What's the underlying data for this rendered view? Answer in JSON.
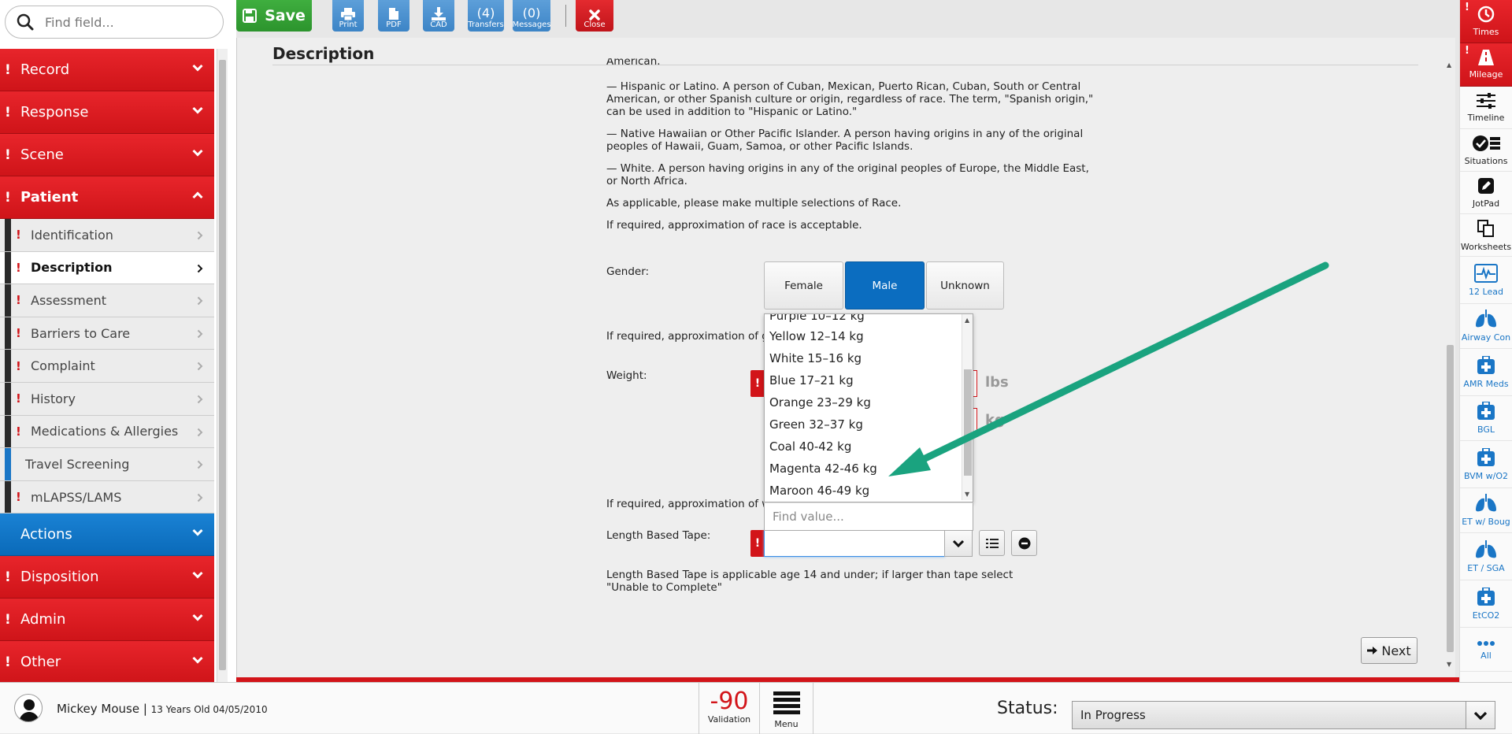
{
  "search": {
    "placeholder": "Find field..."
  },
  "sidebar": {
    "sections_top": [
      {
        "label": "Record",
        "required": true
      },
      {
        "label": "Response",
        "required": true
      },
      {
        "label": "Scene",
        "required": true
      },
      {
        "label": "Patient",
        "required": true,
        "expanded": true
      }
    ],
    "patient_items": [
      {
        "label": "Identification",
        "required": true
      },
      {
        "label": "Description",
        "required": true,
        "active": true
      },
      {
        "label": "Assessment",
        "required": true
      },
      {
        "label": "Barriers to Care",
        "required": true
      },
      {
        "label": "Complaint",
        "required": true
      },
      {
        "label": "History",
        "required": true
      },
      {
        "label": "Medications & Allergies",
        "required": true
      },
      {
        "label": "Travel Screening",
        "required": false
      },
      {
        "label": "mLAPSS/LAMS",
        "required": true
      }
    ],
    "sections_bottom": [
      {
        "label": "Actions",
        "required": false
      },
      {
        "label": "Disposition",
        "required": true
      },
      {
        "label": "Admin",
        "required": true
      },
      {
        "label": "Other",
        "required": true
      }
    ]
  },
  "toolbar": {
    "save_label": "Save",
    "print_label": "Print",
    "pdf_label": "PDF",
    "cad_label": "CAD",
    "transfers_count": "(4)",
    "transfers_label": "Transfers",
    "messages_count": "(0)",
    "messages_label": "Messages",
    "close_label": "Close"
  },
  "main": {
    "title": "Description",
    "race_text": {
      "cut_top": "American.",
      "hispanic": "— Hispanic or Latino. A person of Cuban, Mexican, Puerto Rican, Cuban, South or Central American, or other Spanish culture or origin, regardless of race. The term, \"Spanish origin,\" can be used in addition to \"Hispanic or Latino.\"",
      "hawaiian": "— Native Hawaiian or Other Pacific Islander. A person having origins in any of the original peoples of Hawaii, Guam, Samoa, or other Pacific Islands.",
      "white": "— White. A person having origins in any of the original peoples of Europe, the Middle East, or North Africa.",
      "multiple": "As applicable, please make multiple selections of Race.",
      "approx": "If required, approximation of race is acceptable."
    },
    "gender": {
      "label": "Gender:",
      "options": [
        "Female",
        "Male",
        "Unknown"
      ],
      "selected": "Male",
      "approx": "If required, approximation of ge"
    },
    "weight": {
      "label": "Weight:",
      "unit_lbs": "lbs",
      "unit_kg": "kg",
      "approx": "If required, approximation of we"
    },
    "length_tape": {
      "label": "Length Based Tape:",
      "value": "",
      "note": "Length Based Tape is applicable age 14 and under; if larger than tape select \"Unable to Complete\""
    },
    "dropdown": {
      "options": [
        "Purple 10–12 kg",
        "Yellow 12–14 kg",
        "White 15–16 kg",
        "Blue 17–21 kg",
        "Orange 23–29 kg",
        "Green 32–37 kg",
        "Coal 40-42 kg",
        "Magenta 42-46 kg",
        "Maroon 46-49 kg"
      ],
      "find_placeholder": "Find value..."
    },
    "next_label": "Next",
    "annotation_color": "#1aa37f"
  },
  "rightbar": [
    {
      "label": "Times",
      "icon": "clock-icon",
      "red": true
    },
    {
      "label": "Mileage",
      "icon": "road-icon",
      "red": true
    },
    {
      "label": "Timeline",
      "icon": "sliders-icon",
      "red": false
    },
    {
      "label": "Situations",
      "icon": "check-list-icon",
      "red": false
    },
    {
      "label": "JotPad",
      "icon": "pencil-icon",
      "red": false
    },
    {
      "label": "Worksheets",
      "icon": "copy-icon",
      "red": false
    },
    {
      "label": "12 Lead",
      "icon": "ecg-icon",
      "red": false
    },
    {
      "label": "Airway Con",
      "icon": "lungs-icon",
      "red": false
    },
    {
      "label": "AMR Meds",
      "icon": "medkit-icon",
      "red": false
    },
    {
      "label": "BGL",
      "icon": "medkit-icon",
      "red": false
    },
    {
      "label": "BVM w/O2",
      "icon": "medkit-icon",
      "red": false
    },
    {
      "label": "ET w/ Boug",
      "icon": "lungs-icon",
      "red": false
    },
    {
      "label": "ET / SGA",
      "icon": "lungs-icon",
      "red": false
    },
    {
      "label": "EtCO2",
      "icon": "medkit-icon",
      "red": false
    },
    {
      "label": "All",
      "icon": "ellipsis-icon",
      "red": false
    }
  ],
  "bottombar": {
    "patient_name": "Mickey Mouse",
    "patient_info": "13 Years Old 04/05/2010",
    "validation_count": "-90",
    "validation_label": "Validation",
    "menu_label": "Menu",
    "status_label": "Status:",
    "status_value": "In Progress"
  }
}
